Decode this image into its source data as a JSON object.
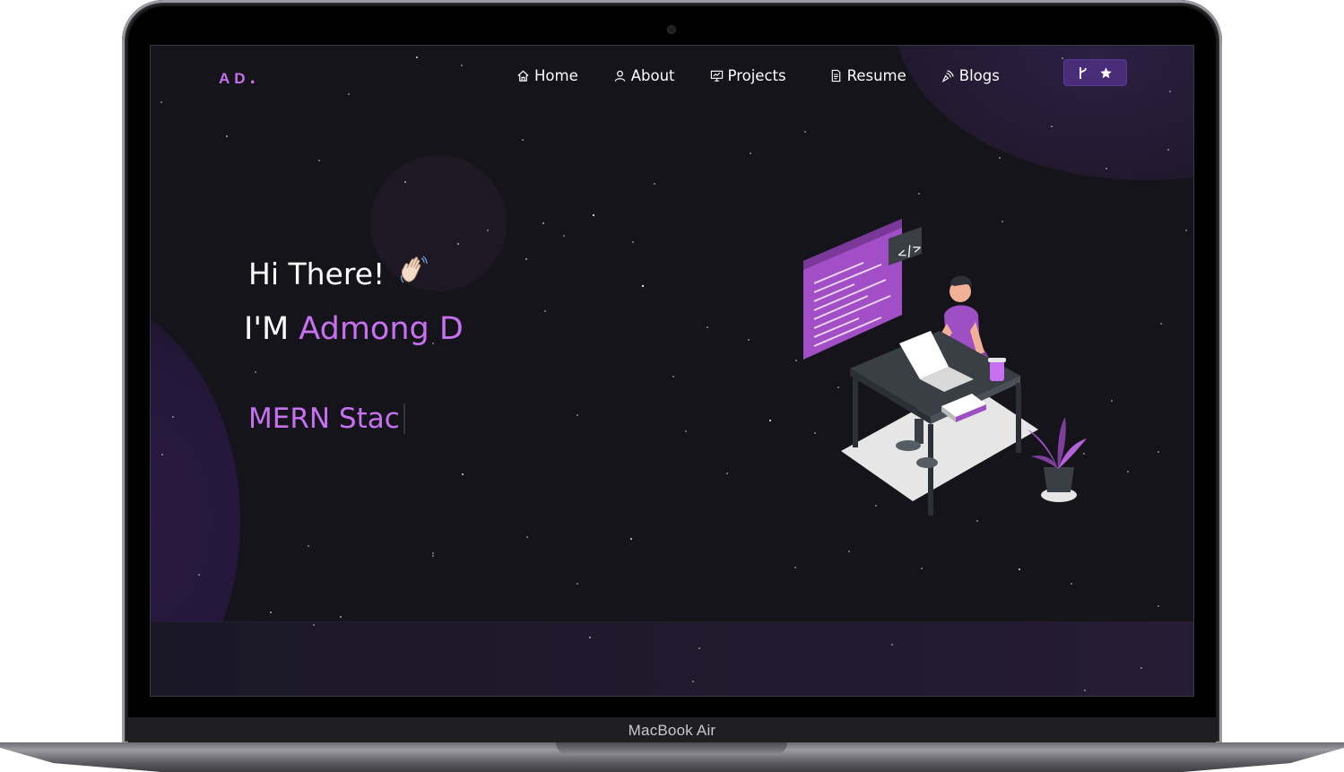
{
  "device": {
    "model_label": "MacBook Air"
  },
  "nav": {
    "logo": "AD",
    "logo_dot": ".",
    "items": [
      {
        "label": "Home",
        "icon": "home-icon"
      },
      {
        "label": "About",
        "icon": "user-icon"
      },
      {
        "label": "Projects",
        "icon": "presentation-icon"
      },
      {
        "label": "Resume",
        "icon": "document-icon"
      },
      {
        "label": "Blogs",
        "icon": "blog-icon"
      }
    ],
    "github_button": {
      "icons": [
        "git-fork-icon",
        "star-icon"
      ]
    }
  },
  "hero": {
    "greeting": "Hi There!",
    "wave_emoji": "👋",
    "intro_prefix": "I'M",
    "name": "Admong D",
    "typed_text": "MERN Stac"
  },
  "colors": {
    "accent": "#c770f0",
    "background": "#15141a",
    "button_bg": "#4a2d78"
  }
}
